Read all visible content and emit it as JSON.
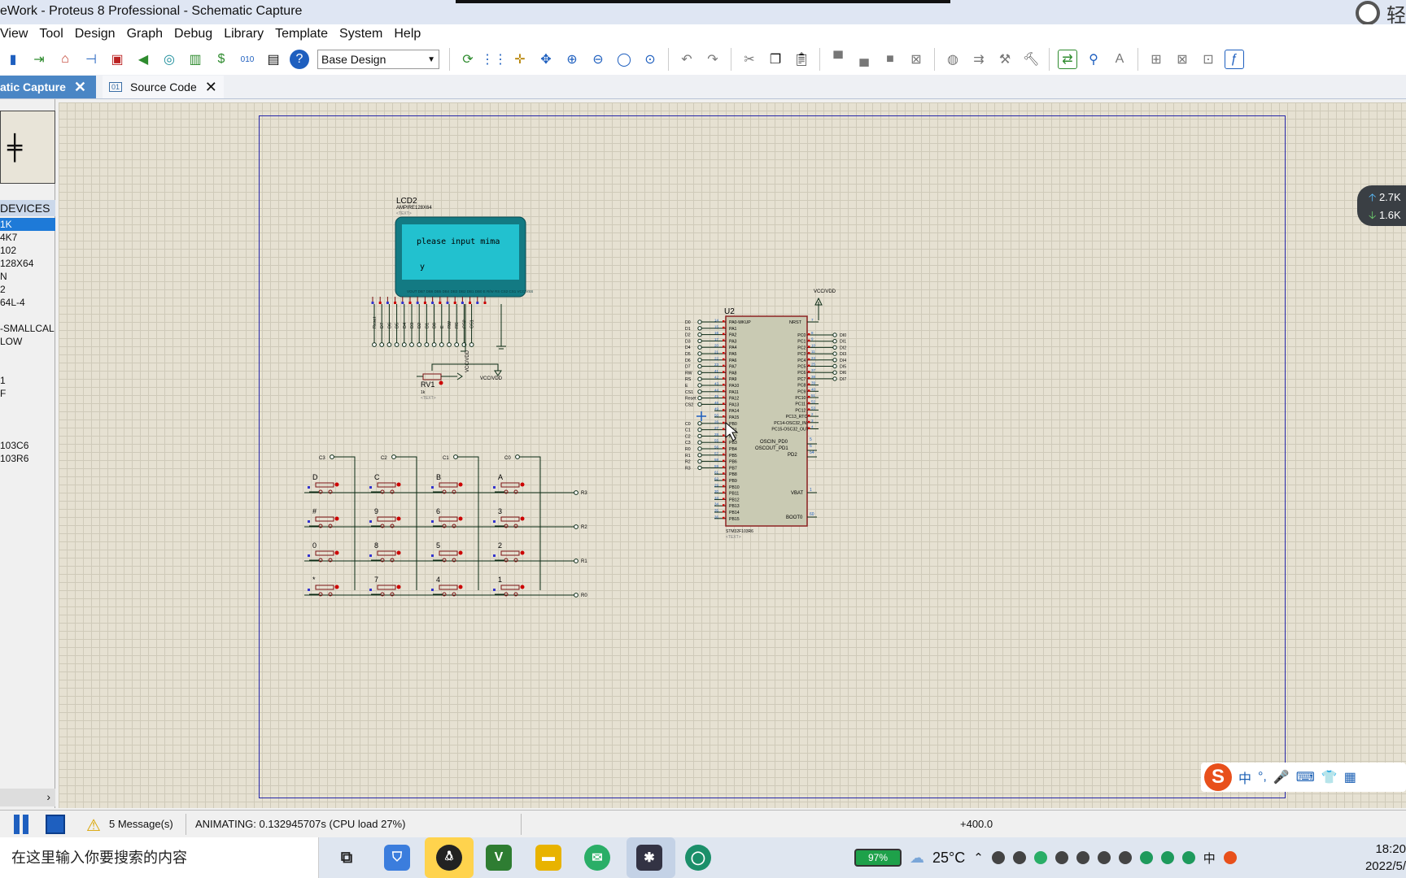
{
  "window": {
    "title": "eWork - Proteus 8 Professional - Schematic Capture",
    "title_right": "轻"
  },
  "menu": [
    "View",
    "Tool",
    "Design",
    "Graph",
    "Debug",
    "Library",
    "Template",
    "System",
    "Help"
  ],
  "toolbar": {
    "design_select": "Base Design"
  },
  "tabs": [
    {
      "label": "atic Capture"
    },
    {
      "label": "Source Code",
      "icon": "01"
    }
  ],
  "devices": {
    "header": "DEVICES",
    "items": [
      "1K",
      "4K7",
      "102",
      "128X64",
      "N",
      "2",
      "64L-4",
      "",
      "-SMALLCAL",
      "LOW",
      "",
      "",
      "1",
      "F",
      "",
      "",
      "",
      "103C6",
      "103R6"
    ]
  },
  "schematic": {
    "lcd": {
      "ref": "LCD2",
      "part": "AMPIRE128X64",
      "text_tag": "<TEXT>",
      "line1": "please input mima",
      "line2": "y",
      "pin_labels": [
        "Reset",
        "D7",
        "D6",
        "D5",
        "D4",
        "D3",
        "D2",
        "D1",
        "D0",
        "E",
        "RW",
        "RS",
        "CS2",
        "CS1"
      ],
      "pin_header": "VOUT  DB7 DB6 DB5 DB4 DB3 DB2 DB1 DB0  E  R/W RS  CS2 CS1 VCC VSS"
    },
    "pot": {
      "ref": "RV1",
      "value": "1k",
      "text_tag": "<TEXT>",
      "vcc": "VCC/VDD",
      "vcc2": "VCC/VDD"
    },
    "keypad": {
      "cols": [
        "C3",
        "C2",
        "C1",
        "C0"
      ],
      "rows": [
        "R3",
        "R2",
        "R1",
        "R0"
      ],
      "keys": [
        [
          "D",
          "C",
          "B",
          "A"
        ],
        [
          "#",
          "9",
          "6",
          "3"
        ],
        [
          "0",
          "8",
          "5",
          "2"
        ],
        [
          "*",
          "7",
          "4",
          "1"
        ]
      ]
    },
    "mcu": {
      "ref": "U2",
      "part": "STM32F103R6",
      "text_tag": "<TEXT>",
      "vcc": "VCC/VDD",
      "left_nets": [
        "D0",
        "D1",
        "D2",
        "D3",
        "D4",
        "D5",
        "D6",
        "D7",
        "RW",
        "RS",
        "E",
        "CS1",
        "Reset",
        "CS2",
        "",
        "",
        "C0",
        "C1",
        "C2",
        "C3",
        "R0",
        "R1",
        "R2",
        "R3"
      ],
      "left_pins": [
        "14",
        "15",
        "16",
        "17",
        "20",
        "21",
        "22",
        "23",
        "41",
        "42",
        "43",
        "44",
        "45",
        "46",
        "49",
        "50",
        "26",
        "27",
        "28",
        "55",
        "56",
        "57",
        "58",
        "59",
        "61",
        "62",
        "29",
        "30",
        "33",
        "34",
        "35",
        "36"
      ],
      "left_labels": [
        "PA0-WKUP",
        "PA1",
        "PA2",
        "PA3",
        "PA4",
        "PA5",
        "PA6",
        "PA7",
        "PA8",
        "PA9",
        "PA10",
        "PA11",
        "PA12",
        "PA13",
        "PA14",
        "PA15",
        "PB0",
        "PB1",
        "PB2",
        "PB3",
        "PB4",
        "PB5",
        "PB6",
        "PB7",
        "PB8",
        "PB9",
        "PB10",
        "PB11",
        "PB12",
        "PB13",
        "PB14",
        "PB15"
      ],
      "right_labels_top": [
        "NRST"
      ],
      "right_labels": [
        "PC0",
        "PC1",
        "PC2",
        "PC3",
        "PC4",
        "PC5",
        "PC6",
        "PC7",
        "PC8",
        "PC9",
        "PC10",
        "PC11",
        "PC12",
        "PC13_RTC",
        "PC14-OSC32_IN",
        "PC15-OSC32_OUT"
      ],
      "right_pins": [
        "7",
        "8",
        "9",
        "10",
        "11",
        "24",
        "25",
        "37",
        "38",
        "39",
        "40",
        "51",
        "52",
        "53",
        "2",
        "3",
        "4"
      ],
      "right_nets": [
        "DI0",
        "DI1",
        "DI2",
        "DI3",
        "DI4",
        "DI5",
        "DI6",
        "DI7"
      ],
      "osc_labels": [
        "OSCIN_PD0",
        "OSCOUT_PD1",
        "PD2"
      ],
      "osc_pins": [
        "5",
        "6",
        "54"
      ],
      "vbat": "VBAT",
      "vbat_pin": "1",
      "boot": "BOOT0",
      "boot_pin": "60"
    }
  },
  "net_badge": {
    "up": "2.7K",
    "down": "1.6K"
  },
  "ime": {
    "lang": "中",
    "punct": "°,",
    "mic": "🎤",
    "kb": "⌨",
    "skin": "👕",
    "grid": "▦"
  },
  "status": {
    "messages": "5 Message(s)",
    "animating": "ANIMATING: 0.132945707s (CPU load 27%)",
    "coord": "+400.0"
  },
  "taskbar": {
    "search_placeholder": "在这里输入你要搜索的内容",
    "battery": "97%",
    "temperature": "25°C",
    "ime_tray": "中",
    "time": "18:20",
    "date": "2022/5/"
  },
  "colors": {
    "sheet_border": "#2626a8",
    "lcd_screen": "#22c1cf",
    "lcd_frame": "#137a83",
    "wire": "#0b2a14",
    "mcu_body": "#c9cab3",
    "mcu_outline": "#8c2222",
    "accent": "#1e5fbf"
  }
}
